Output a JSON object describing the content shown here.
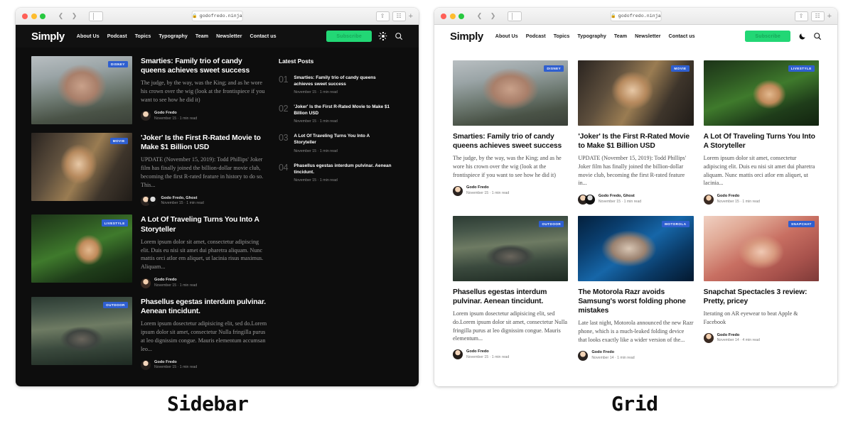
{
  "browser": {
    "url": "godofredo.ninja",
    "lock_icon": "lock-icon",
    "back_icon": "chevron-left-icon",
    "forward_icon": "chevron-right-icon",
    "sidebar_icon": "sidebar-toggle-icon",
    "share_icon": "share-icon",
    "tabs_icon": "new-tab-icon",
    "plus_icon": "plus-icon"
  },
  "site": {
    "brand": "Simply",
    "nav": [
      "About Us",
      "Podcast",
      "Topics",
      "Typography",
      "Team",
      "Newsletter",
      "Contact us"
    ],
    "subscribe_label": "Subscribe",
    "subscribe_color": "#22d775",
    "search_icon": "search-icon",
    "theme_icon_dark_variant": "sun-icon",
    "theme_icon_light_variant": "moon-icon"
  },
  "sidebar_view": {
    "caption": "Sidebar",
    "posts": [
      {
        "badge": "DISNEY",
        "title": "Smarties: Family trio of candy queens achieves sweet success",
        "excerpt": "The judge, by the way, was the King; and as he wore his crown over the  wig (look at the frontispiece if you want to see how he did it)",
        "author": "Godo Fredo",
        "date": "November 15 · 1 min read",
        "image": "img-disney",
        "avatars": [
          "av-a"
        ]
      },
      {
        "badge": "MOVIE",
        "title": "'Joker' Is the First R-Rated Movie to Make $1 Billion USD",
        "excerpt": "UPDATE (November 15, 2019): Todd Phillips' Joker film has finally joined the billion-dollar movie club, becoming the first R-rated feature in history to do so. This...",
        "author": "Godo Fredo, Ghost",
        "date": "November 15 · 1 min read",
        "image": "img-movie",
        "avatars": [
          "av-a",
          "av-b"
        ]
      },
      {
        "badge": "LIVESTYLE",
        "title": "A Lot Of Traveling Turns You Into A Storyteller",
        "excerpt": "Lorem ipsum dolor sit amet, consectetur adipiscing elit. Duis eu nisi sit amet dui pharetra aliquam. Nunc mattis orci atlor em aliquet, ut lacinia risus maximus. Aliquam...",
        "author": "Godo Fredo",
        "date": "November 15 · 1 min read",
        "image": "img-livestyle",
        "avatars": [
          "av-c"
        ]
      },
      {
        "badge": "OUTDOOR",
        "title": "Phasellus egestas interdum pulvinar. Aenean tincidunt.",
        "excerpt": "Lorem ipsum dosectetur adipisicing elit, sed do.Lorem ipsum dolor sit amet, consectetur Nulla fringilla purus at leo dignissim congue. Mauris elementum accumsan leo...",
        "author": "Godo Fredo",
        "date": "November 15 · 1 min read",
        "image": "img-outdoor",
        "avatars": [
          "av-d"
        ]
      }
    ],
    "latest": {
      "heading": "Latest Posts",
      "items": [
        {
          "num": "01",
          "title": "Smarties: Family trio of candy queens achieves sweet success",
          "date": "November 15 · 1 min read"
        },
        {
          "num": "02",
          "title": "'Joker' Is the First R-Rated Movie to Make $1 Billion USD",
          "date": "November 15 · 1 min read"
        },
        {
          "num": "03",
          "title": "A Lot Of Traveling Turns You Into A Storyteller",
          "date": "November 15 · 1 min read"
        },
        {
          "num": "04",
          "title": "Phasellus egestas interdum pulvinar. Aenean tincidunt.",
          "date": "November 15 · 1 min read"
        }
      ]
    }
  },
  "grid_view": {
    "caption": "Grid",
    "cards": [
      {
        "badge": "DISNEY",
        "title": "Smarties: Family trio of candy queens achieves sweet success",
        "excerpt": "The judge, by the way, was the King; and as he wore his crown over the  wig (look at the frontispiece if you want to see how he did it)",
        "author": "Godo Fredo",
        "date": "November 15 · 1 min read",
        "image": "img-disney",
        "avatars": [
          "av-a"
        ]
      },
      {
        "badge": "MOVIE",
        "title": "'Joker' Is the First R-Rated Movie to Make $1 Billion USD",
        "excerpt": "UPDATE (November 15, 2019): Todd Phillips' Joker film has finally joined the billion-dollar movie club, becoming the first R-rated feature in...",
        "author": "Godo Fredo, Ghost",
        "date": "November 15 · 1 min read",
        "image": "img-movie",
        "avatars": [
          "av-a",
          "av-b"
        ]
      },
      {
        "badge": "LIVESTYLE",
        "title": "A Lot Of Traveling Turns You Into A Storyteller",
        "excerpt": "Lorem ipsum dolor sit amet, consectetur adipiscing elit. Duis eu nisi sit amet dui pharetra aliquam. Nunc mattis orci atlor em aliquet, ut lacinia...",
        "author": "Godo Fredo",
        "date": "November 15 · 1 min read",
        "image": "img-livestyle",
        "avatars": [
          "av-c"
        ]
      },
      {
        "badge": "OUTDOOR",
        "title": "Phasellus egestas interdum pulvinar. Aenean tincidunt.",
        "excerpt": "Lorem ipsum dosectetur adipisicing elit, sed do.Lorem ipsum dolor sit amet, consectetur Nulla fringilla purus at leo dignissim congue. Mauris elementum...",
        "author": "Godo Fredo",
        "date": "November 15 · 1 min read",
        "image": "img-outdoor",
        "avatars": [
          "av-d"
        ]
      },
      {
        "badge": "MOTOROLA",
        "title": "The Motorola Razr avoids Samsung's worst folding phone mistakes",
        "excerpt": "Late last night, Motorola announced the new Razr phone, which is a much-leaked folding device that looks exactly like a wider version of the...",
        "author": "Godo Fredo",
        "date": "November 14 · 1 min read",
        "image": "img-motorola",
        "avatars": [
          "av-a"
        ]
      },
      {
        "badge": "SNAPCHAT",
        "title": "Snapchat Spectacles 3 review: Pretty, pricey",
        "excerpt": "Iterating on AR eyewear to beat Apple & Facebook",
        "author": "Godo Fredo",
        "date": "November 14 · 4 min read",
        "image": "img-snapchat",
        "avatars": [
          "av-c"
        ]
      }
    ]
  }
}
